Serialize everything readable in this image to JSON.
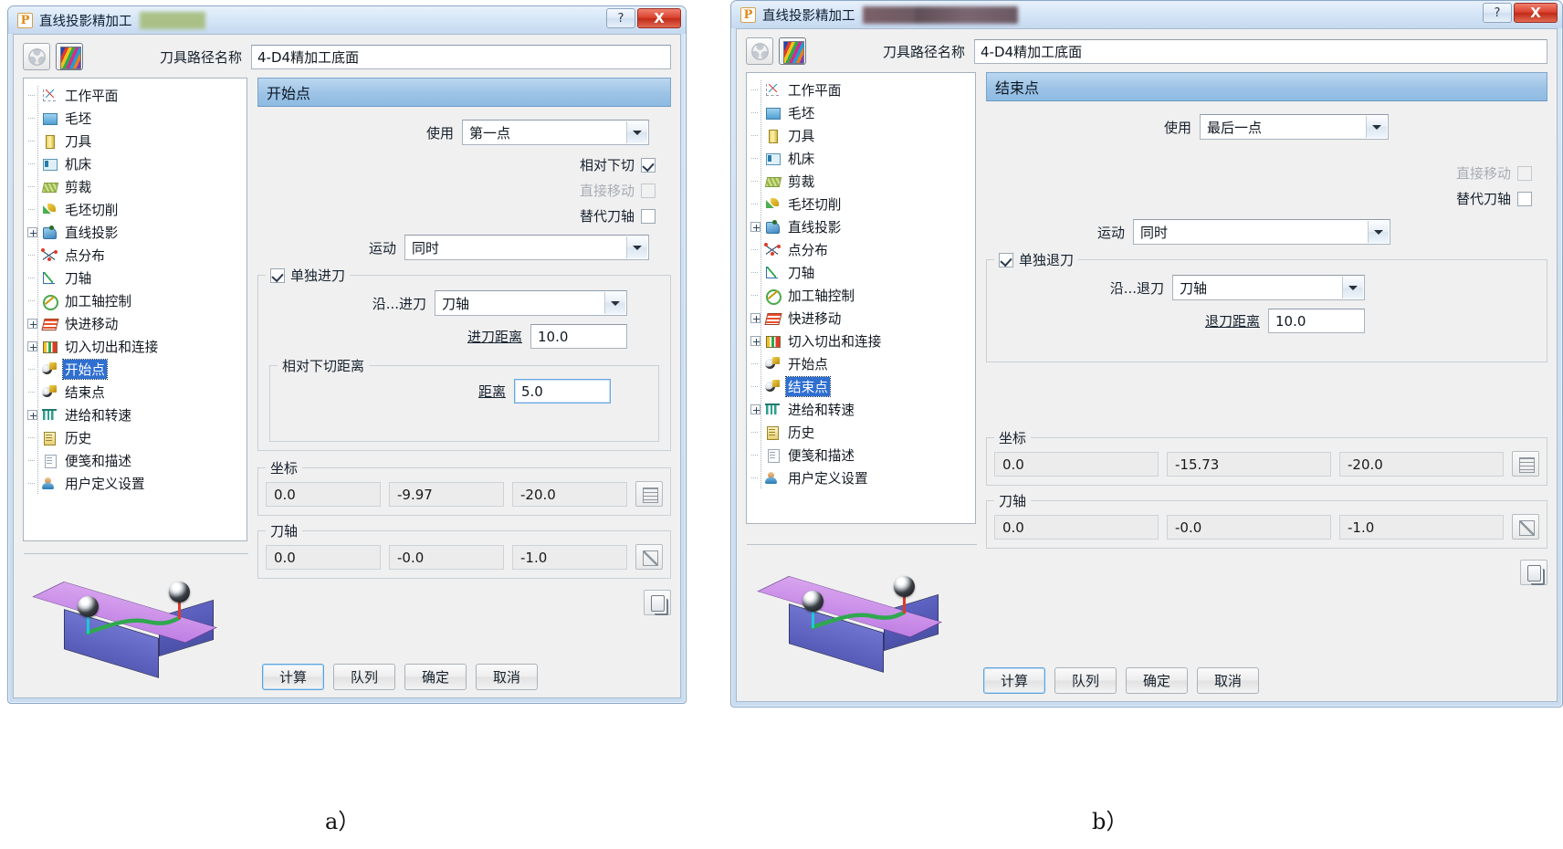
{
  "window_title": "直线投影精加工",
  "titlebar": {
    "help_label": "?",
    "close_label": "X"
  },
  "toolbar": {
    "path_name_label": "刀具路径名称",
    "path_name_value": "4-D4精加工底面",
    "icon_mesh": "mesh-icon",
    "icon_color": "color-strip-icon"
  },
  "tree": {
    "items": [
      {
        "label": "工作平面",
        "icon": "work-plane-icon",
        "expander": "none",
        "selected": false
      },
      {
        "label": "毛坯",
        "icon": "stock-icon",
        "expander": "none",
        "selected": false
      },
      {
        "label": "刀具",
        "icon": "tool-icon",
        "expander": "none",
        "selected": false
      },
      {
        "label": "机床",
        "icon": "machine-icon",
        "expander": "none",
        "selected": false
      },
      {
        "label": "剪裁",
        "icon": "trim-icon",
        "expander": "none",
        "selected": false
      },
      {
        "label": "毛坯切削",
        "icon": "stock-cut-icon",
        "expander": "none",
        "selected": false
      },
      {
        "label": "直线投影",
        "icon": "line-projection-icon",
        "expander": "plus",
        "selected": false
      },
      {
        "label": "点分布",
        "icon": "point-distribution-icon",
        "expander": "none",
        "selected": false
      },
      {
        "label": "刀轴",
        "icon": "tool-axis-icon",
        "expander": "none",
        "selected": false
      },
      {
        "label": "加工轴控制",
        "icon": "axis-control-icon",
        "expander": "none",
        "selected": false
      },
      {
        "label": "快进移动",
        "icon": "rapid-move-icon",
        "expander": "plus",
        "selected": false
      },
      {
        "label": "切入切出和连接",
        "icon": "lead-link-icon",
        "expander": "plus",
        "selected": false
      },
      {
        "label": "开始点",
        "icon": "start-point-icon",
        "expander": "none",
        "selected": true
      },
      {
        "label": "结束点",
        "icon": "end-point-icon",
        "expander": "none",
        "selected": false
      },
      {
        "label": "进给和转速",
        "icon": "feed-speed-icon",
        "expander": "plus",
        "selected": false
      },
      {
        "label": "历史",
        "icon": "history-icon",
        "expander": "none",
        "selected": false
      },
      {
        "label": "便笺和描述",
        "icon": "notes-icon",
        "expander": "none",
        "selected": false
      },
      {
        "label": "用户定义设置",
        "icon": "user-settings-icon",
        "expander": "none",
        "selected": false
      }
    ]
  },
  "panel_a": {
    "section_title": "开始点",
    "use_label": "使用",
    "use_value": "第一点",
    "checkboxes": [
      {
        "label": "相对下切",
        "checked": true,
        "disabled": false
      },
      {
        "label": "直接移动",
        "checked": false,
        "disabled": true
      },
      {
        "label": "替代刀轴",
        "checked": false,
        "disabled": false
      }
    ],
    "motion_label": "运动",
    "motion_value": "同时",
    "group_title": "单独进刀",
    "group_checked": true,
    "along_label": "沿...进刀",
    "along_value": "刀轴",
    "distance_link": "进刀距离",
    "distance_value": "10.0",
    "sub_group_title": "相对下切距离",
    "sub_distance_link": "距离",
    "sub_distance_value": "5.0",
    "coords_title": "坐标",
    "coords": [
      "0.0",
      "-9.97",
      "-20.0"
    ],
    "axis_title": "刀轴",
    "axis": [
      "0.0",
      "-0.0",
      "-1.0"
    ],
    "coords_btn": "coordinate-picker-button",
    "axis_btn": "axis-picker-button",
    "copy_btn": "copy-button"
  },
  "panel_b": {
    "section_title": "结束点",
    "use_label": "使用",
    "use_value": "最后一点",
    "checkboxes": [
      {
        "label": "直接移动",
        "checked": false,
        "disabled": true
      },
      {
        "label": "替代刀轴",
        "checked": false,
        "disabled": false
      }
    ],
    "motion_label": "运动",
    "motion_value": "同时",
    "group_title": "单独退刀",
    "group_checked": true,
    "along_label": "沿...退刀",
    "along_value": "刀轴",
    "distance_link": "退刀距离",
    "distance_value": "10.0",
    "coords_title": "坐标",
    "coords": [
      "0.0",
      "-15.73",
      "-20.0"
    ],
    "axis_title": "刀轴",
    "axis": [
      "0.0",
      "-0.0",
      "-1.0"
    ],
    "coords_btn": "coordinate-picker-button",
    "axis_btn": "axis-picker-button",
    "copy_btn": "copy-button"
  },
  "buttons": {
    "calculate": "计算",
    "queue": "队列",
    "ok": "确定",
    "cancel": "取消"
  },
  "captions": {
    "a": "a）",
    "b": "b）"
  },
  "colors": {
    "accent_header": "#9cc3e6",
    "selection": "#2f6fd0",
    "link": "#1a4fbd",
    "close_button": "#d9402c",
    "preview_top": "#c07fe4",
    "preview_side": "#575bb8",
    "preview_path": "#2fa84f"
  }
}
